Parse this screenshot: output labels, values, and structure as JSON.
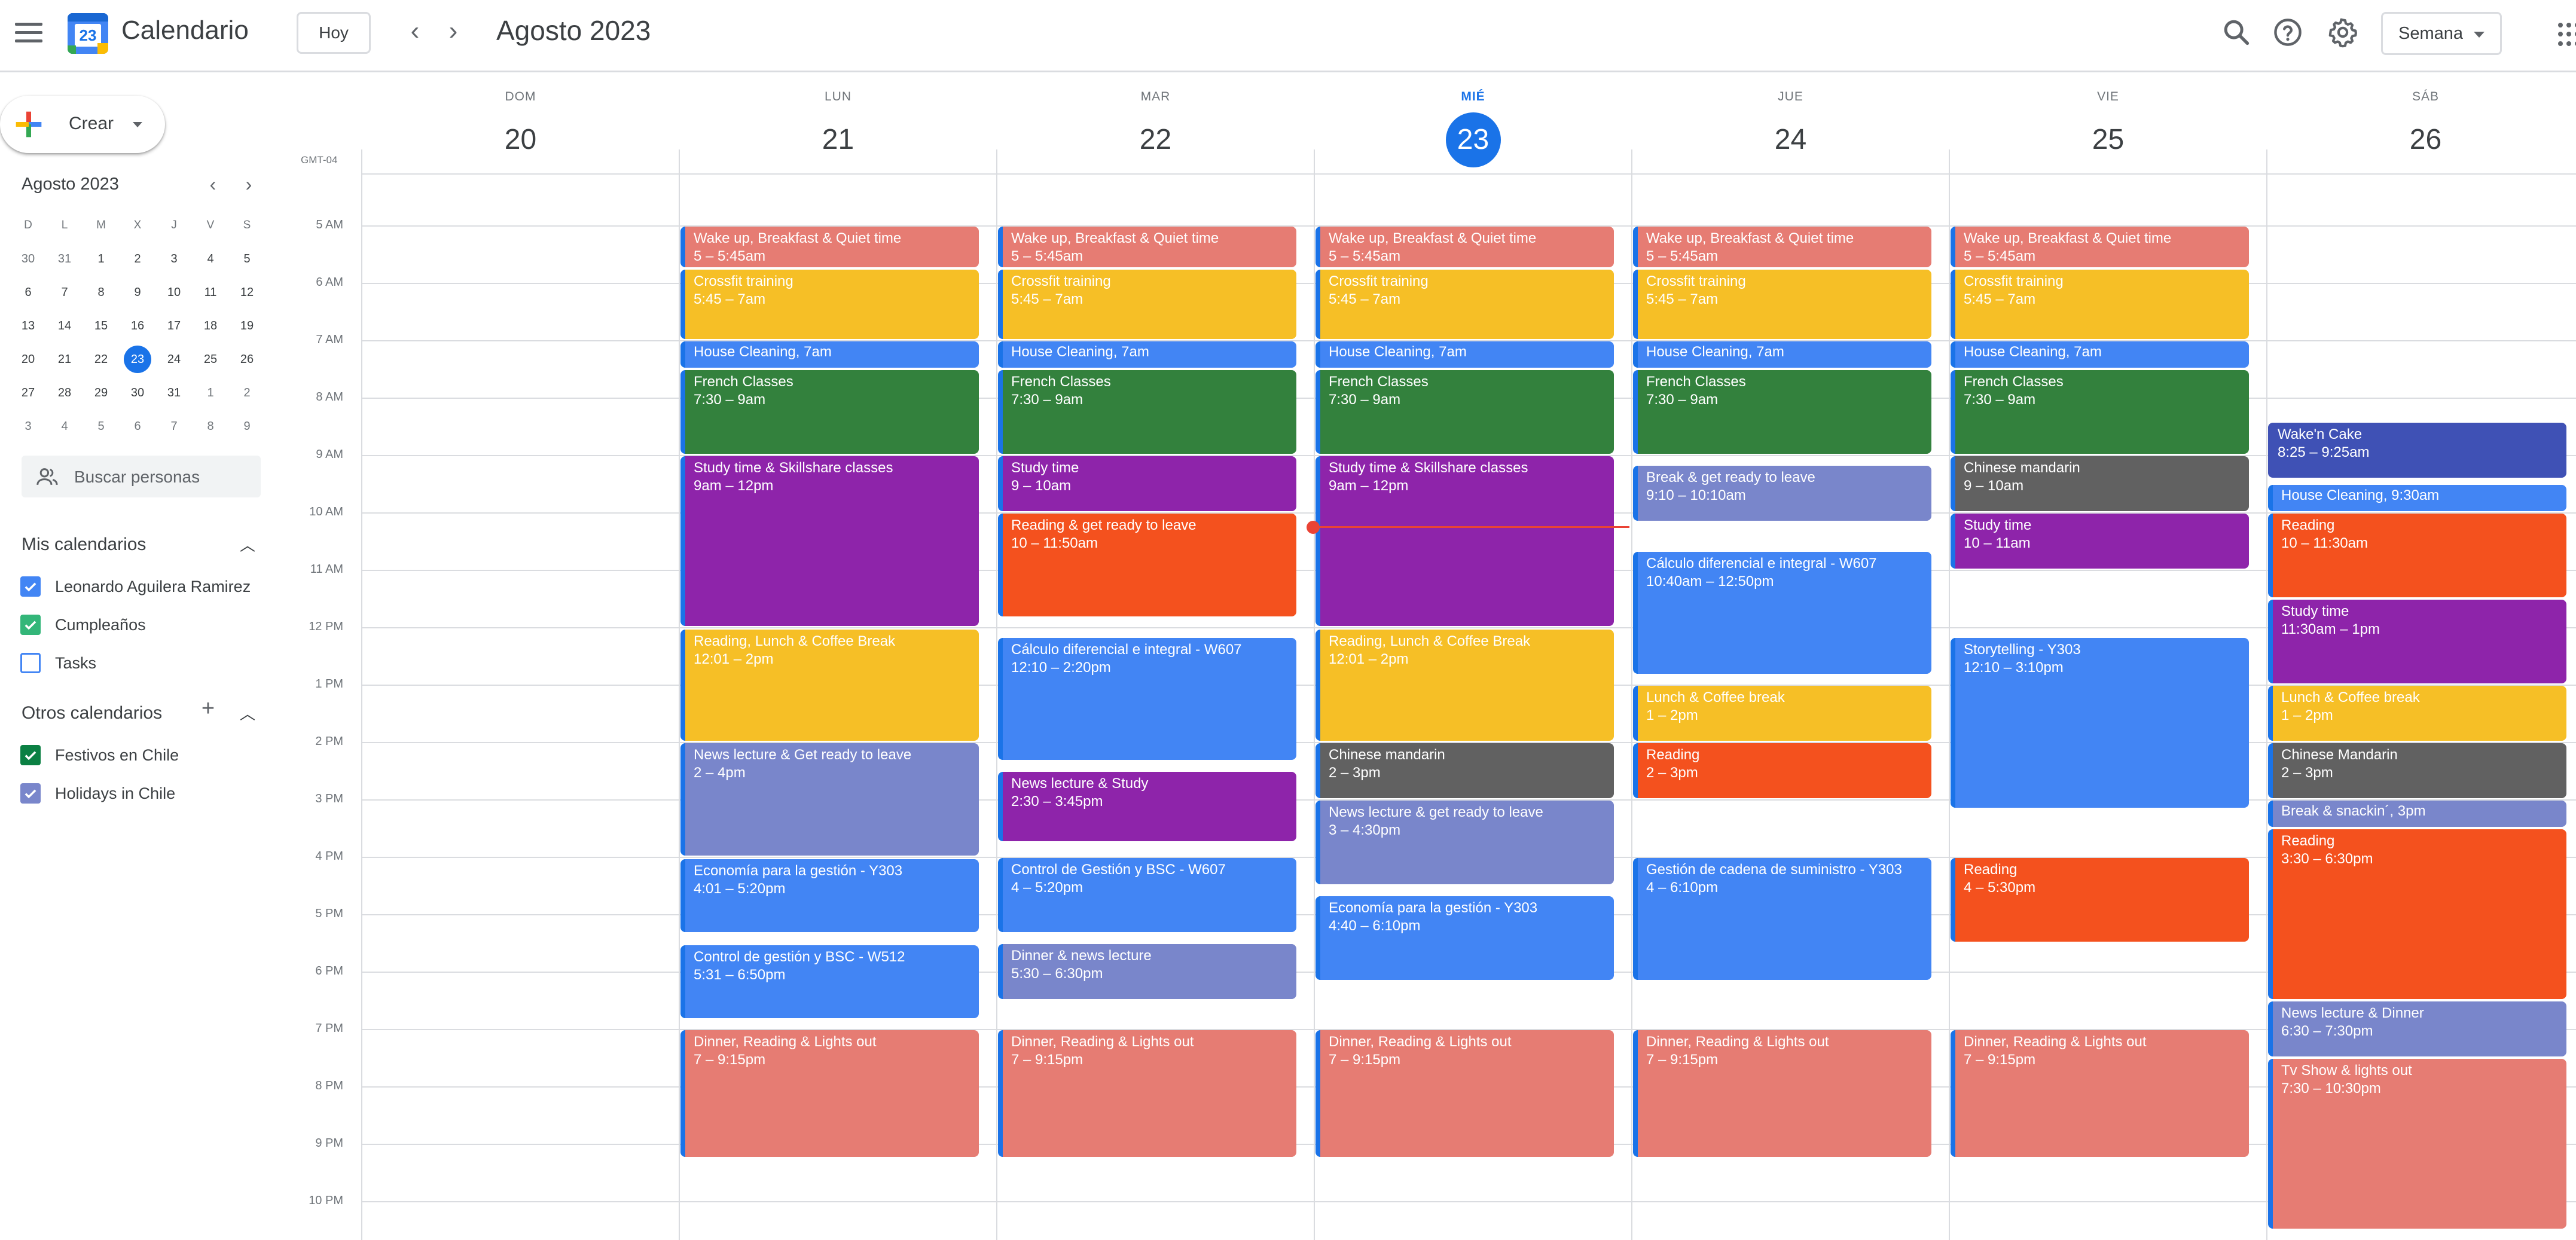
{
  "header": {
    "app_title": "Calendario",
    "logo_number": "23",
    "today_label": "Hoy",
    "month_title": "Agosto 2023",
    "view_label": "Semana",
    "icons": [
      "menu-icon",
      "calendar-logo-icon",
      "chevron-left-icon",
      "chevron-right-icon",
      "search-icon",
      "help-icon",
      "settings-icon",
      "apps-grid-icon"
    ]
  },
  "sidebar": {
    "create_label": "Crear",
    "mini_calendar": {
      "title": "Agosto 2023",
      "weekdays": [
        "D",
        "L",
        "M",
        "X",
        "J",
        "V",
        "S"
      ],
      "weeks": [
        [
          "30",
          "31",
          "1",
          "2",
          "3",
          "4",
          "5"
        ],
        [
          "6",
          "7",
          "8",
          "9",
          "10",
          "11",
          "12"
        ],
        [
          "13",
          "14",
          "15",
          "16",
          "17",
          "18",
          "19"
        ],
        [
          "20",
          "21",
          "22",
          "23",
          "24",
          "25",
          "26"
        ],
        [
          "27",
          "28",
          "29",
          "30",
          "31",
          "1",
          "2"
        ],
        [
          "3",
          "4",
          "5",
          "6",
          "7",
          "8",
          "9"
        ]
      ],
      "today": "23"
    },
    "search_people_placeholder": "Buscar personas",
    "my_calendars_title": "Mis calendarios",
    "my_calendars": [
      {
        "name": "Leonardo Aguilera Ramirez",
        "checked": true,
        "color": "#4285f4"
      },
      {
        "name": "Cumpleaños",
        "checked": true,
        "color": "#33b679"
      },
      {
        "name": "Tasks",
        "checked": false,
        "color": "#4285f4"
      }
    ],
    "other_calendars_title": "Otros calendarios",
    "other_calendars": [
      {
        "name": "Festivos en Chile",
        "checked": true,
        "color": "#0b8043"
      },
      {
        "name": "Holidays in Chile",
        "checked": true,
        "color": "#7986cb"
      }
    ]
  },
  "grid": {
    "timezone": "GMT-04",
    "days": [
      {
        "name": "DOM",
        "date": "20",
        "today": false
      },
      {
        "name": "LUN",
        "date": "21",
        "today": false
      },
      {
        "name": "MAR",
        "date": "22",
        "today": false
      },
      {
        "name": "MIÉ",
        "date": "23",
        "today": true
      },
      {
        "name": "JUE",
        "date": "24",
        "today": false
      },
      {
        "name": "VIE",
        "date": "25",
        "today": false
      },
      {
        "name": "SÁB",
        "date": "26",
        "today": false
      }
    ],
    "hours": [
      "5 AM",
      "6 AM",
      "7 AM",
      "8 AM",
      "9 AM",
      "10 AM",
      "11 AM",
      "12 PM",
      "1 PM",
      "2 PM",
      "3 PM",
      "4 PM",
      "5 PM",
      "6 PM",
      "7 PM",
      "8 PM",
      "9 PM",
      "10 PM"
    ],
    "events": [
      {
        "day": 1,
        "start": 5,
        "end": 5.75,
        "title": "Wake up, Breakfast & Quiet time",
        "time": "5 – 5:45am",
        "color": "#e67c73"
      },
      {
        "day": 1,
        "start": 5.75,
        "end": 7,
        "title": "Crossfit training",
        "time": "5:45 – 7am",
        "color": "#f6bf26"
      },
      {
        "day": 1,
        "start": 7,
        "end": 7.5,
        "title": "House Cleaning",
        "time": "7am",
        "color": "#4285f4",
        "short": true
      },
      {
        "day": 1,
        "start": 7.5,
        "end": 9,
        "title": "French Classes",
        "time": "7:30 – 9am",
        "color": "#33813d"
      },
      {
        "day": 1,
        "start": 9,
        "end": 12,
        "title": "Study time & Skillshare classes",
        "time": "9am – 12pm",
        "color": "#8e24aa"
      },
      {
        "day": 1,
        "start": 12.0167,
        "end": 14,
        "title": "Reading, Lunch & Coffee Break",
        "time": "12:01 – 2pm",
        "color": "#f6bf26"
      },
      {
        "day": 1,
        "start": 14,
        "end": 16,
        "title": "News lecture & Get ready to leave",
        "time": "2 – 4pm",
        "color": "#7986cb"
      },
      {
        "day": 1,
        "start": 16.0167,
        "end": 17.333,
        "title": "Economía para la gestión - Y303",
        "time": "4:01 – 5:20pm",
        "color": "#4285f4"
      },
      {
        "day": 1,
        "start": 17.5167,
        "end": 18.833,
        "title": "Control de gestión y BSC - W512",
        "time": "5:31 – 6:50pm",
        "color": "#4285f4"
      },
      {
        "day": 1,
        "start": 19,
        "end": 21.25,
        "title": "Dinner, Reading & Lights out",
        "time": "7 – 9:15pm",
        "color": "#e67c73"
      },
      {
        "day": 2,
        "start": 5,
        "end": 5.75,
        "title": "Wake up, Breakfast & Quiet time",
        "time": "5 – 5:45am",
        "color": "#e67c73"
      },
      {
        "day": 2,
        "start": 5.75,
        "end": 7,
        "title": "Crossfit training",
        "time": "5:45 – 7am",
        "color": "#f6bf26"
      },
      {
        "day": 2,
        "start": 7,
        "end": 7.5,
        "title": "House Cleaning",
        "time": "7am",
        "color": "#4285f4",
        "short": true
      },
      {
        "day": 2,
        "start": 7.5,
        "end": 9,
        "title": "French Classes",
        "time": "7:30 – 9am",
        "color": "#33813d"
      },
      {
        "day": 2,
        "start": 9,
        "end": 10,
        "title": "Study time",
        "time": "9 – 10am",
        "color": "#8e24aa"
      },
      {
        "day": 2,
        "start": 10,
        "end": 11.833,
        "title": "Reading & get ready to leave",
        "time": "10 – 11:50am",
        "color": "#f4511e"
      },
      {
        "day": 2,
        "start": 12.1667,
        "end": 14.333,
        "title": "Cálculo diferencial e integral - W607",
        "time": "12:10 – 2:20pm",
        "color": "#4285f4"
      },
      {
        "day": 2,
        "start": 14.5,
        "end": 15.75,
        "title": "News lecture & Study",
        "time": "2:30 – 3:45pm",
        "color": "#8e24aa"
      },
      {
        "day": 2,
        "start": 16,
        "end": 17.333,
        "title": "Control de Gestión y BSC - W607",
        "time": "4 – 5:20pm",
        "color": "#4285f4"
      },
      {
        "day": 2,
        "start": 17.5,
        "end": 18.5,
        "title": "Dinner & news lecture",
        "time": "5:30 – 6:30pm",
        "color": "#7986cb"
      },
      {
        "day": 2,
        "start": 19,
        "end": 21.25,
        "title": "Dinner, Reading & Lights out",
        "time": "7 – 9:15pm",
        "color": "#e67c73"
      },
      {
        "day": 3,
        "start": 5,
        "end": 5.75,
        "title": "Wake up, Breakfast & Quiet time",
        "time": "5 – 5:45am",
        "color": "#e67c73"
      },
      {
        "day": 3,
        "start": 5.75,
        "end": 7,
        "title": "Crossfit training",
        "time": "5:45 – 7am",
        "color": "#f6bf26"
      },
      {
        "day": 3,
        "start": 7,
        "end": 7.5,
        "title": "House Cleaning",
        "time": "7am",
        "color": "#4285f4",
        "short": true
      },
      {
        "day": 3,
        "start": 7.5,
        "end": 9,
        "title": "French Classes",
        "time": "7:30 – 9am",
        "color": "#33813d"
      },
      {
        "day": 3,
        "start": 9,
        "end": 12,
        "title": "Study time & Skillshare classes",
        "time": "9am – 12pm",
        "color": "#8e24aa"
      },
      {
        "day": 3,
        "start": 12.0167,
        "end": 14,
        "title": "Reading, Lunch & Coffee Break",
        "time": "12:01 – 2pm",
        "color": "#f6bf26"
      },
      {
        "day": 3,
        "start": 14,
        "end": 15,
        "title": "Chinese mandarin",
        "time": "2 – 3pm",
        "color": "#616161"
      },
      {
        "day": 3,
        "start": 15,
        "end": 16.5,
        "title": "News lecture & get ready to leave",
        "time": "3 – 4:30pm",
        "color": "#7986cb"
      },
      {
        "day": 3,
        "start": 16.6667,
        "end": 18.1667,
        "title": "Economía para la gestión - Y303",
        "time": "4:40 – 6:10pm",
        "color": "#4285f4"
      },
      {
        "day": 3,
        "start": 19,
        "end": 21.25,
        "title": "Dinner, Reading & Lights out",
        "time": "7 – 9:15pm",
        "color": "#e67c73"
      },
      {
        "day": 4,
        "start": 5,
        "end": 5.75,
        "title": "Wake up, Breakfast & Quiet time",
        "time": "5 – 5:45am",
        "color": "#e67c73"
      },
      {
        "day": 4,
        "start": 5.75,
        "end": 7,
        "title": "Crossfit training",
        "time": "5:45 – 7am",
        "color": "#f6bf26"
      },
      {
        "day": 4,
        "start": 7,
        "end": 7.5,
        "title": "House Cleaning",
        "time": "7am",
        "color": "#4285f4",
        "short": true
      },
      {
        "day": 4,
        "start": 7.5,
        "end": 9,
        "title": "French Classes",
        "time": "7:30 – 9am",
        "color": "#33813d"
      },
      {
        "day": 4,
        "start": 9.1667,
        "end": 10.1667,
        "title": "Break & get ready to leave",
        "time": "9:10 – 10:10am",
        "color": "#7986cb"
      },
      {
        "day": 4,
        "start": 10.6667,
        "end": 12.8333,
        "title": "Cálculo diferencial e integral - W607",
        "time": "10:40am – 12:50pm",
        "color": "#4285f4"
      },
      {
        "day": 4,
        "start": 13,
        "end": 14,
        "title": "Lunch & Coffee break",
        "time": "1 – 2pm",
        "color": "#f6bf26"
      },
      {
        "day": 4,
        "start": 14,
        "end": 15,
        "title": "Reading",
        "time": "2 – 3pm",
        "color": "#f4511e"
      },
      {
        "day": 4,
        "start": 16,
        "end": 18.1667,
        "title": "Gestión de cadena de suministro - Y303",
        "time": "4 – 6:10pm",
        "color": "#4285f4"
      },
      {
        "day": 4,
        "start": 19,
        "end": 21.25,
        "title": "Dinner, Reading & Lights out",
        "time": "7 – 9:15pm",
        "color": "#e67c73"
      },
      {
        "day": 5,
        "start": 5,
        "end": 5.75,
        "title": "Wake up, Breakfast & Quiet time",
        "time": "5 – 5:45am",
        "color": "#e67c73"
      },
      {
        "day": 5,
        "start": 5.75,
        "end": 7,
        "title": "Crossfit training",
        "time": "5:45 – 7am",
        "color": "#f6bf26"
      },
      {
        "day": 5,
        "start": 7,
        "end": 7.5,
        "title": "House Cleaning",
        "time": "7am",
        "color": "#4285f4",
        "short": true
      },
      {
        "day": 5,
        "start": 7.5,
        "end": 9,
        "title": "French Classes",
        "time": "7:30 – 9am",
        "color": "#33813d"
      },
      {
        "day": 5,
        "start": 9,
        "end": 10,
        "title": "Chinese mandarin",
        "time": "9 – 10am",
        "color": "#616161"
      },
      {
        "day": 5,
        "start": 10,
        "end": 11,
        "title": "Study time",
        "time": "10 – 11am",
        "color": "#8e24aa"
      },
      {
        "day": 5,
        "start": 12.1667,
        "end": 15.1667,
        "title": "Storytelling - Y303",
        "time": "12:10 – 3:10pm",
        "color": "#4285f4"
      },
      {
        "day": 5,
        "start": 16,
        "end": 17.5,
        "title": "Reading",
        "time": "4 – 5:30pm",
        "color": "#f4511e"
      },
      {
        "day": 5,
        "start": 19,
        "end": 21.25,
        "title": "Dinner, Reading & Lights out",
        "time": "7 – 9:15pm",
        "color": "#e67c73"
      },
      {
        "day": 6,
        "start": 8.4167,
        "end": 9.4167,
        "title": "Wake'n Cake",
        "time": "8:25 – 9:25am",
        "color": "#3f51b5"
      },
      {
        "day": 6,
        "start": 9.5,
        "end": 10,
        "title": "House Cleaning",
        "time": "9:30am",
        "color": "#4285f4",
        "short": true
      },
      {
        "day": 6,
        "start": 10,
        "end": 11.5,
        "title": "Reading",
        "time": "10 – 11:30am",
        "color": "#f4511e"
      },
      {
        "day": 6,
        "start": 11.5,
        "end": 13,
        "title": "Study time",
        "time": "11:30am – 1pm",
        "color": "#8e24aa"
      },
      {
        "day": 6,
        "start": 13,
        "end": 14,
        "title": "Lunch & Coffee break",
        "time": "1 – 2pm",
        "color": "#f6bf26"
      },
      {
        "day": 6,
        "start": 14,
        "end": 15,
        "title": "Chinese Mandarin",
        "time": "2 – 3pm",
        "color": "#616161"
      },
      {
        "day": 6,
        "start": 15,
        "end": 15.5,
        "title": "Break & snackin´",
        "time": "3pm",
        "color": "#7986cb",
        "short": true
      },
      {
        "day": 6,
        "start": 15.5,
        "end": 18.5,
        "title": "Reading",
        "time": "3:30 – 6:30pm",
        "color": "#f4511e"
      },
      {
        "day": 6,
        "start": 18.5,
        "end": 19.5,
        "title": "News lecture & Dinner",
        "time": "6:30 – 7:30pm",
        "color": "#7986cb"
      },
      {
        "day": 6,
        "start": 19.5,
        "end": 22.5,
        "title": "Tv Show & lights out",
        "time": "7:30 – 10:30pm",
        "color": "#e67c73"
      }
    ]
  }
}
